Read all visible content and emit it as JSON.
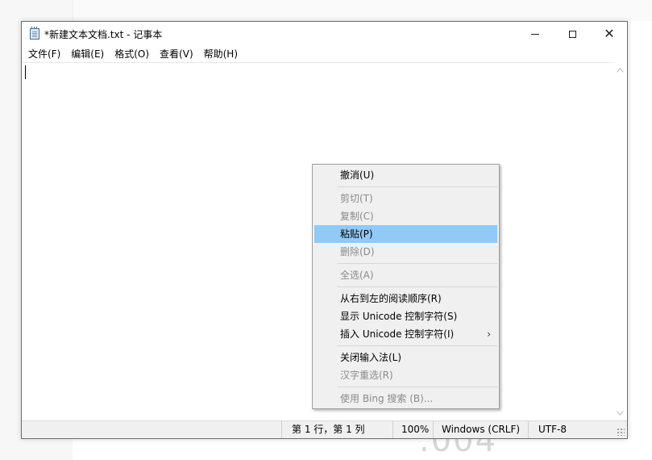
{
  "window": {
    "title": "*新建文本文档.txt - 记事本",
    "close_glyph": "✕"
  },
  "menubar": {
    "items": [
      "文件(F)",
      "编辑(E)",
      "格式(O)",
      "查看(V)",
      "帮助(H)"
    ]
  },
  "editor": {
    "content": ""
  },
  "statusbar": {
    "position": "第 1 行，第 1 列",
    "zoom": "100%",
    "line_ending": "Windows (CRLF)",
    "encoding": "UTF-8"
  },
  "background": {
    "watermark": ".004"
  },
  "context_menu": {
    "items": [
      {
        "label": "撤消(U)"
      },
      {
        "label": "剪切(T)"
      },
      {
        "label": "复制(C)"
      },
      {
        "label": "粘贴(P)"
      },
      {
        "label": "删除(D)"
      },
      {
        "label": "全选(A)"
      },
      {
        "label": "从右到左的阅读顺序(R)"
      },
      {
        "label": "显示 Unicode 控制字符(S)"
      },
      {
        "label": "插入 Unicode 控制字符(I)",
        "submenu_glyph": "›"
      },
      {
        "label": "关闭输入法(L)"
      },
      {
        "label": "汉字重选(R)"
      },
      {
        "label": "使用 Bing 搜索 (B)..."
      }
    ]
  },
  "colors": {
    "highlight": "#91c9f7",
    "disabled_text": "#8a8a8a",
    "menu_background": "#f0f0f0"
  }
}
